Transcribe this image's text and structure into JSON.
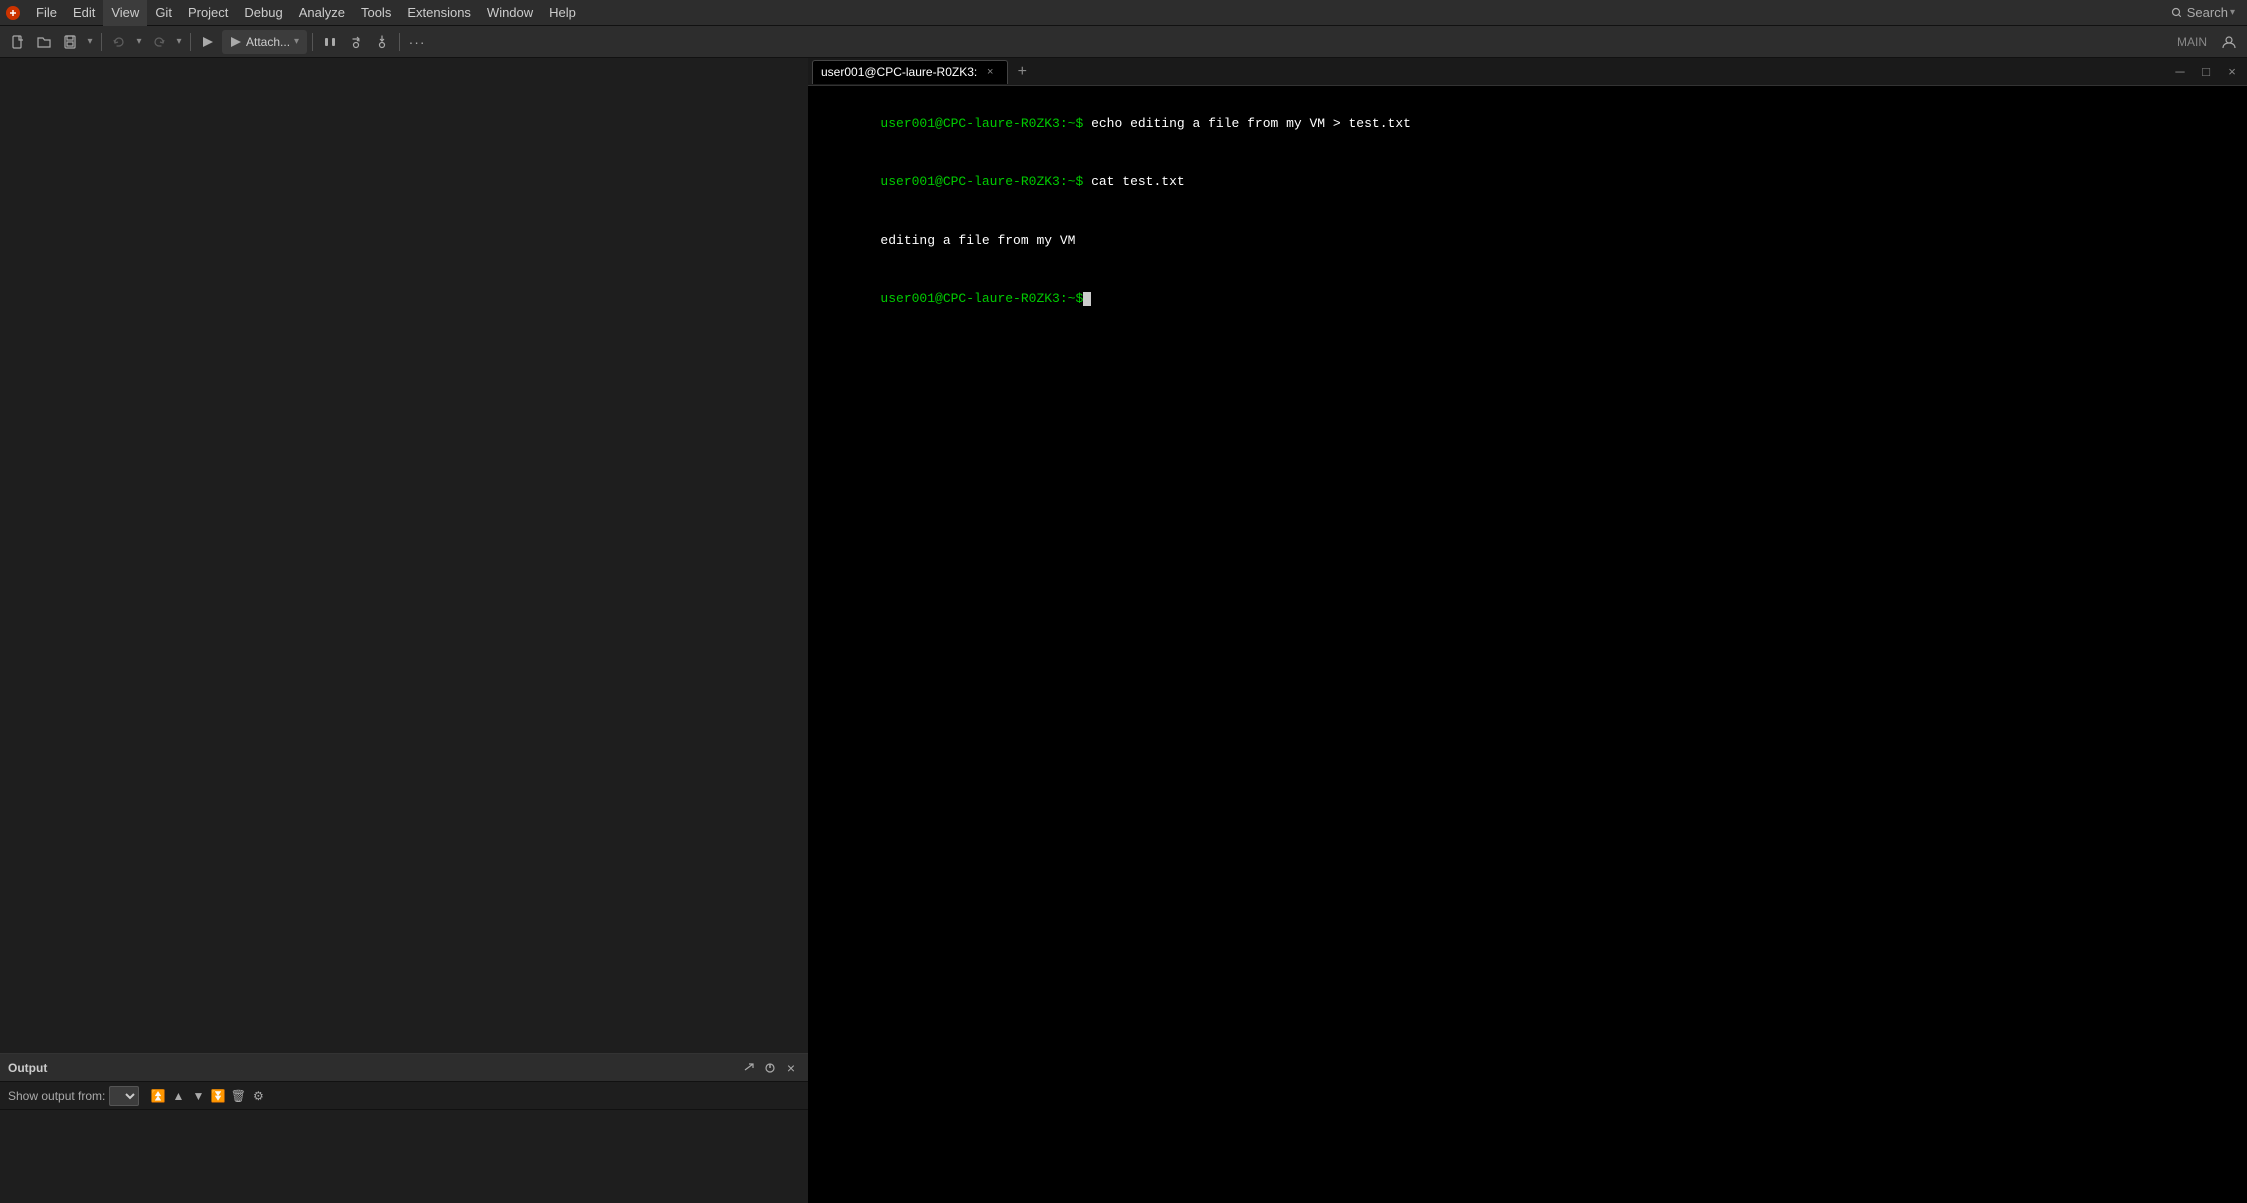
{
  "menubar": {
    "items": [
      "File",
      "Edit",
      "View",
      "Git",
      "Project",
      "Debug",
      "Analyze",
      "Tools",
      "Extensions",
      "Window",
      "Help"
    ],
    "search_label": "Search"
  },
  "toolbar": {
    "main_label": "MAIN",
    "attach_label": "Attach...",
    "buttons": [
      "new-file",
      "open-file",
      "save",
      "undo",
      "redo",
      "build",
      "run",
      "debug",
      "breakpoint",
      "step-over",
      "step-into",
      "step-out",
      "more"
    ]
  },
  "output": {
    "title": "Output",
    "filter_label": "Show output from:",
    "filter_placeholder": ""
  },
  "terminal": {
    "tab_label": "user001@CPC-laure-R0ZK3:",
    "tab_close_symbol": "×",
    "add_symbol": "+",
    "lines": [
      {
        "prompt": "user001@CPC-laure-R0ZK3:~$",
        "command": " echo editing a file from my VM > test.txt"
      },
      {
        "prompt": "user001@CPC-laure-R0ZK3:~$",
        "command": " cat test.txt"
      },
      {
        "output": "editing a file from my VM"
      },
      {
        "prompt": "user001@CPC-laure-R0ZK3:~$",
        "command": "",
        "cursor": true
      }
    ],
    "window_controls": [
      "minimize",
      "maximize",
      "close"
    ]
  }
}
